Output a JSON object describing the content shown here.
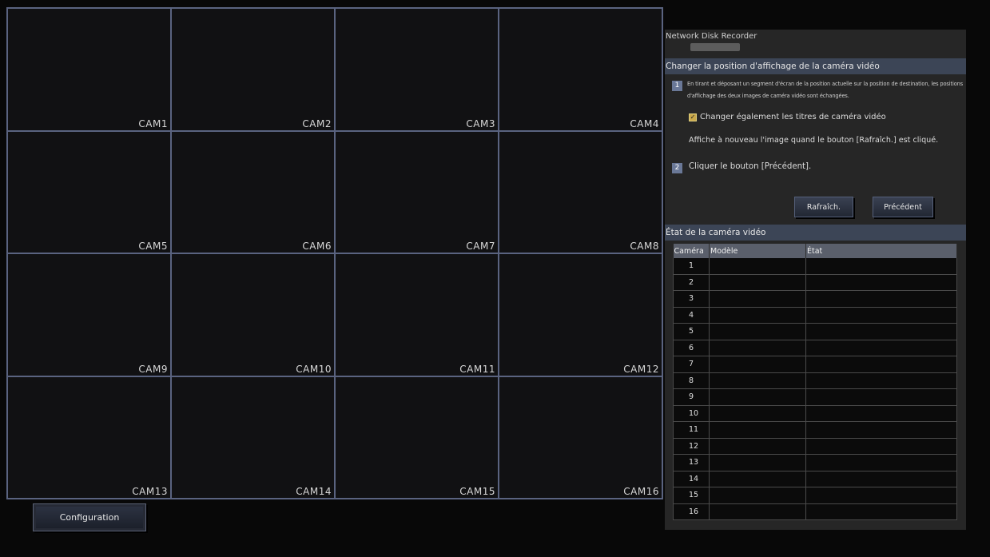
{
  "cameras": [
    "CAM1",
    "CAM2",
    "CAM3",
    "CAM4",
    "CAM5",
    "CAM6",
    "CAM7",
    "CAM8",
    "CAM9",
    "CAM10",
    "CAM11",
    "CAM12",
    "CAM13",
    "CAM14",
    "CAM15",
    "CAM16"
  ],
  "config_button": "Configuration",
  "panel": {
    "title": "Network Disk Recorder",
    "section1": "Changer la position d'affichage de la caméra vidéo",
    "step1_num": "1",
    "step1_text": "En tirant et déposant un segment d'écran de la position actuelle sur la position de destination, les positions d'affichage des deux images de caméra vidéo sont échangées.",
    "checkbox_label": "Changer également les titres de caméra vidéo",
    "checkbox_checked": true,
    "refresh_note": "Affiche à nouveau l'image quand le bouton [Rafraîch.] est cliqué.",
    "step2_num": "2",
    "step2_text": "Cliquer le bouton [Précédent].",
    "refresh_button": "Rafraîch.",
    "back_button": "Précédent",
    "section2": "État de la caméra vidéo"
  },
  "table": {
    "headers": [
      "Caméra",
      "Modèle",
      "État"
    ],
    "rows": [
      "1",
      "2",
      "3",
      "4",
      "5",
      "6",
      "7",
      "8",
      "9",
      "10",
      "11",
      "12",
      "13",
      "14",
      "15",
      "16"
    ]
  },
  "colors": {
    "grid_line": "#5a6380",
    "section_bar": "#3c4556",
    "step_badge": "#6a7897"
  },
  "icons": {
    "checkbox": "checkmark-icon"
  }
}
